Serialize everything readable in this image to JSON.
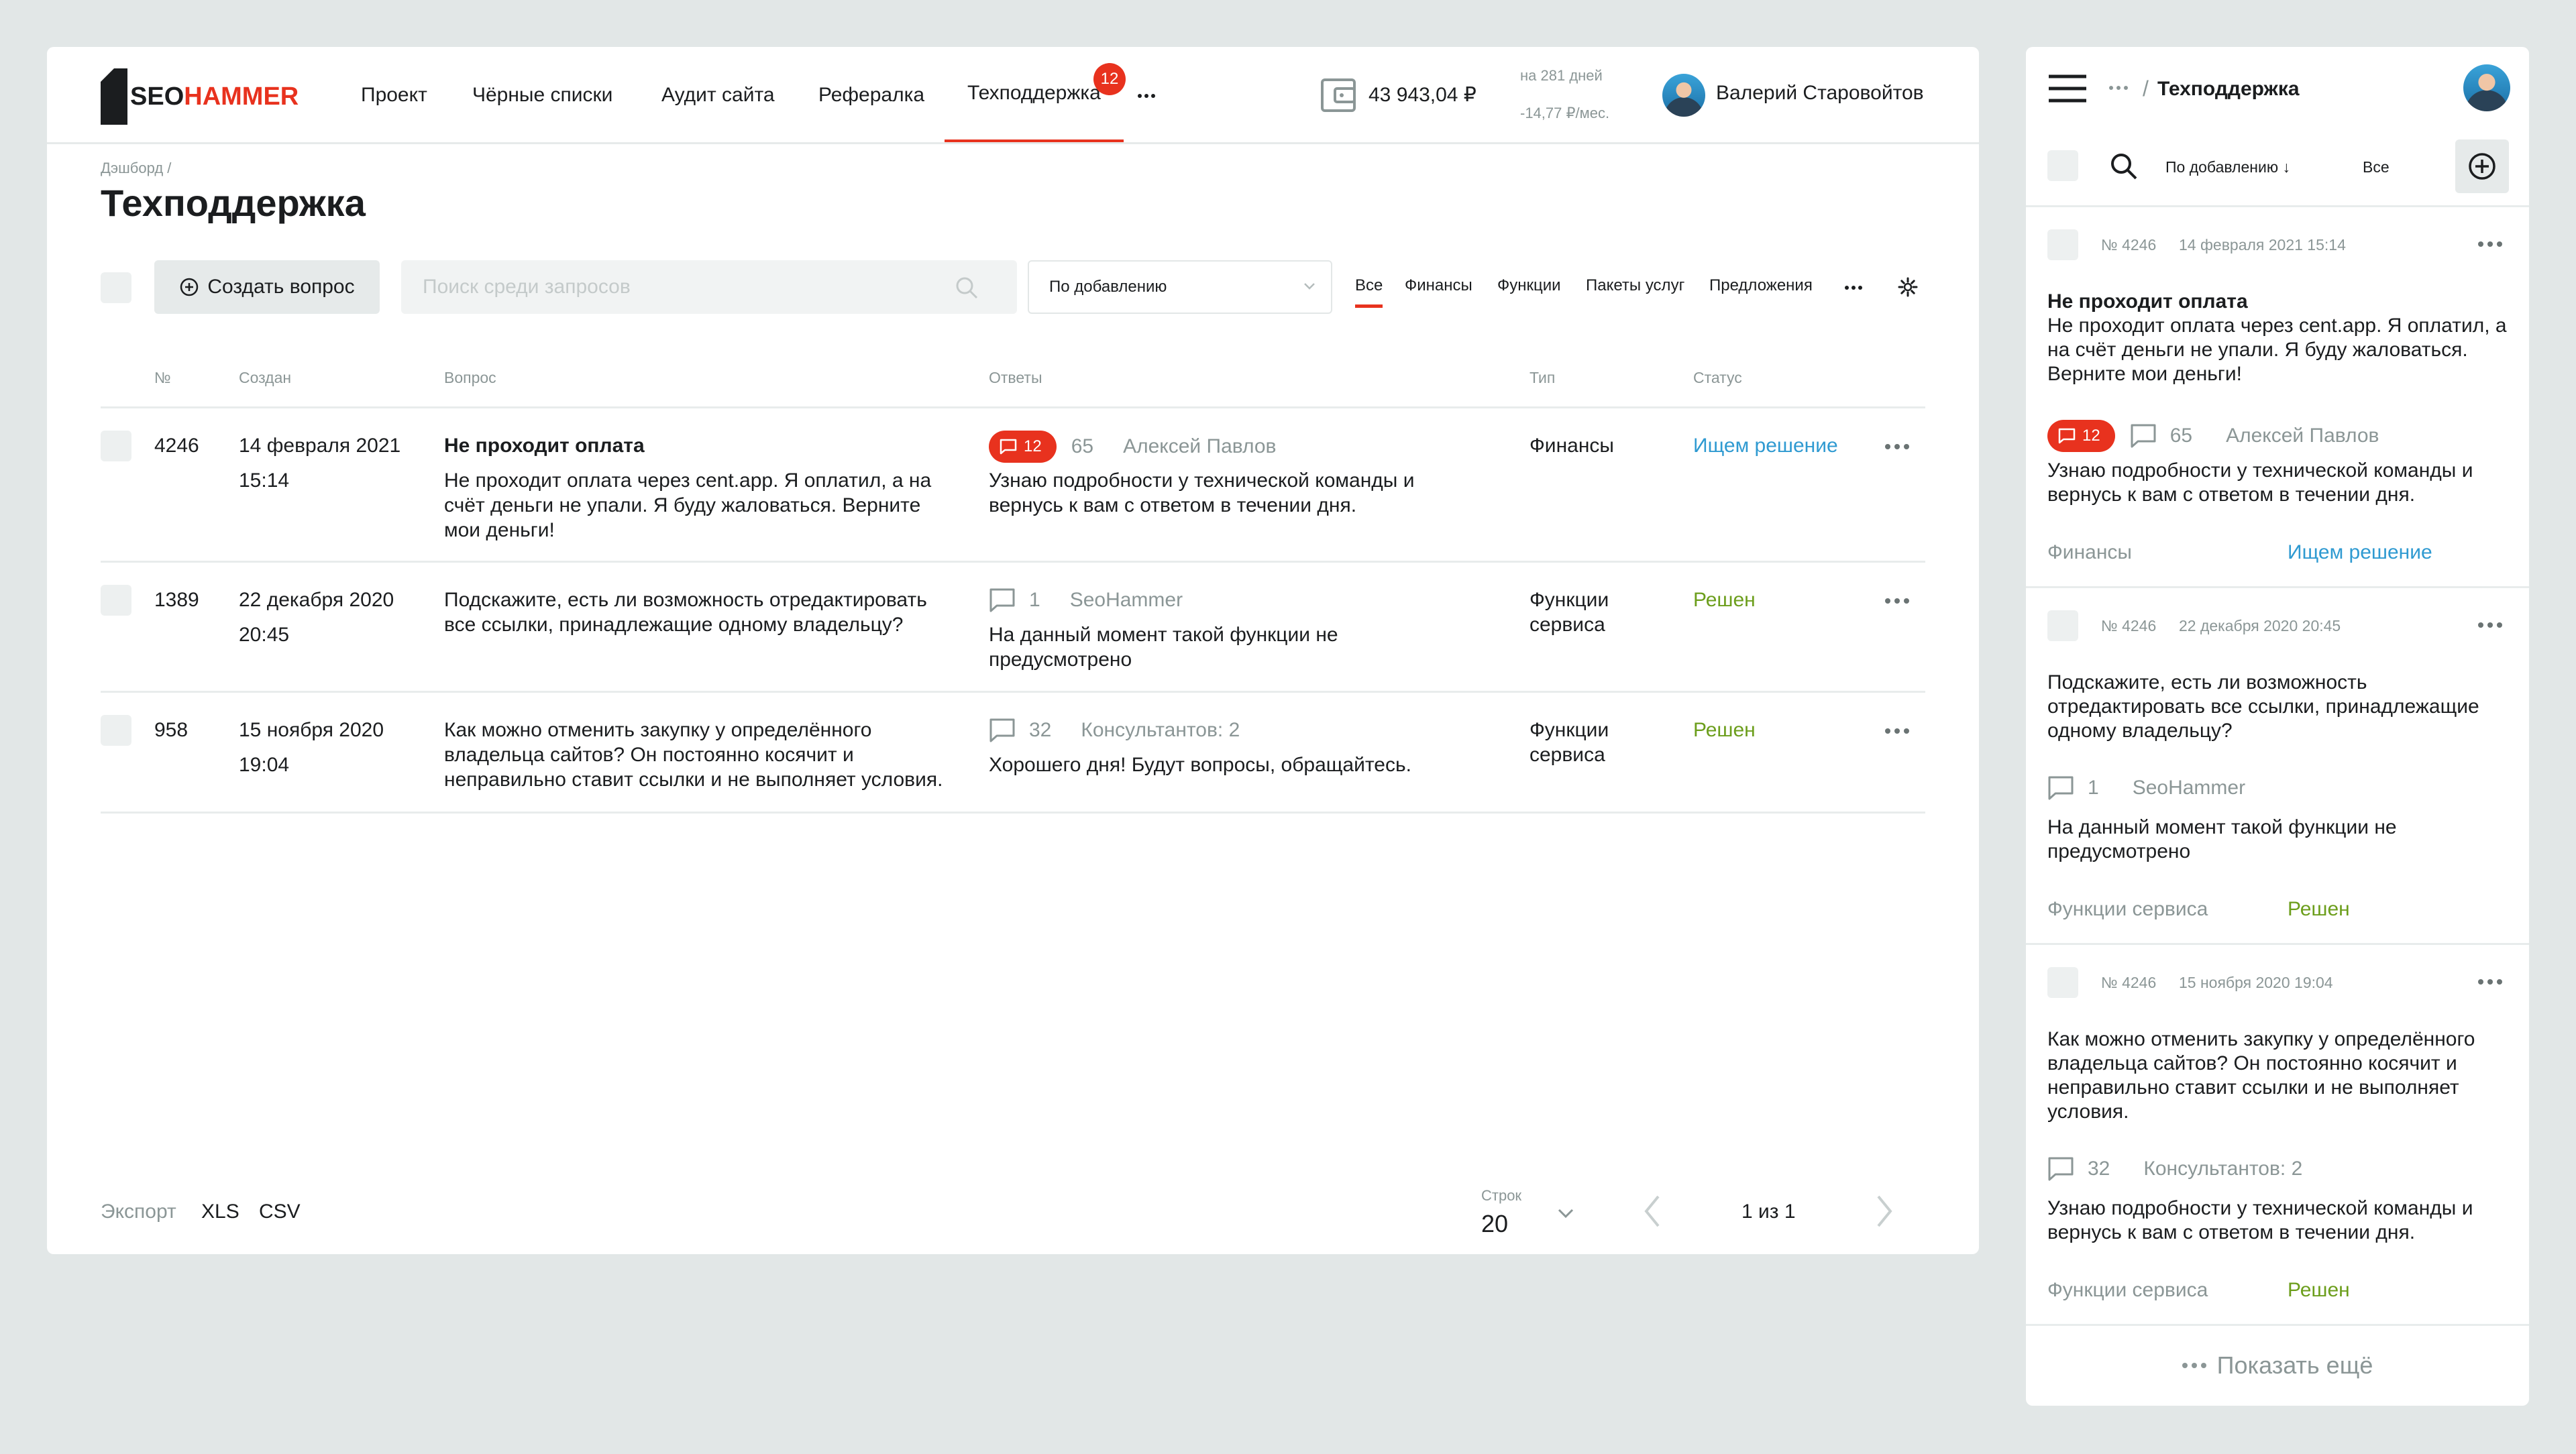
{
  "header": {
    "logo_part1": "SEO",
    "logo_part2": "HAMMER",
    "nav": [
      {
        "label": "Проект"
      },
      {
        "label": "Чёрные списки"
      },
      {
        "label": "Аудит сайта"
      },
      {
        "label": "Рефералка"
      },
      {
        "label": "Техподдержка",
        "badge": "12",
        "active": true
      }
    ],
    "balance": "43 943,04 ₽",
    "days": "на 281 дней",
    "per_month": "-14,77 ₽/мес.",
    "user_name": "Валерий Старовойтов"
  },
  "breadcrumb": "Дэшборд /",
  "page_title": "Техподдержка",
  "toolbar": {
    "create_label": "Создать вопрос",
    "search_placeholder": "Поиск среди запросов",
    "sort_label": "По добавлению",
    "filters": [
      "Все",
      "Финансы",
      "Функции",
      "Пакеты услуг",
      "Предложения"
    ]
  },
  "table": {
    "headers": [
      "№",
      "Создан",
      "Вопрос",
      "Ответы",
      "Тип",
      "Статус"
    ],
    "rows": [
      {
        "id": "4246",
        "date": "14 февраля 2021",
        "time": "15:14",
        "title": "Не проходит оплата",
        "q1": "Не проходит оплата через cent.app. Я оплатил, а на",
        "q2": "счёт деньги не упали. Я буду жаловаться. Верните",
        "q3": "мои деньги!",
        "unread": "12",
        "count": "65",
        "author": "Алексей Павлов",
        "a1": "Узнаю подробности у технической команды и",
        "a2": "вернусь к вам с ответом в течении дня.",
        "type1": "Финансы",
        "type2": "",
        "status": "Ищем решение"
      },
      {
        "id": "1389",
        "date": "22 декабря 2020",
        "time": "20:45",
        "q1": "Подскажите, есть ли возможность отредактировать",
        "q2": "все ссылки, принадлежащие одному владельцу?",
        "count": "1",
        "author": "SeoHammer",
        "a1": "На данный момент такой функции не",
        "a2": "предусмотрено",
        "type1": "Функции",
        "type2": "сервиса",
        "status": "Решен"
      },
      {
        "id": "958",
        "date": "15 ноября 2020",
        "time": "19:04",
        "q1": "Как можно отменить закупку у определённого",
        "q2": "владельца сайтов? Он постоянно косячит и",
        "q3": "неправильно ставит ссылки и не выполняет условия.",
        "count": "32",
        "author": "Консультантов: 2",
        "a1": "Хорошего дня! Будут вопросы, обращайтесь.",
        "type1": "Функции",
        "type2": "сервиса",
        "status": "Решен"
      }
    ]
  },
  "footer": {
    "export_label": "Экспорт",
    "xls": "XLS",
    "csv": "CSV",
    "rows_label": "Строк",
    "rows_value": "20",
    "page_info": "1 из 1"
  },
  "side": {
    "title": "Техподдержка",
    "sort_label": "По добавлению ↓",
    "filter_label": "Все",
    "cards": [
      {
        "num": "№ 4246",
        "date": "14 февраля 2021 15:14",
        "title": "Не проходит оплата",
        "q1": "Не проходит оплата через cent.app. Я оплатил, а",
        "q2": "на счёт деньги не упали. Я буду жаловаться.",
        "q3": "Верните мои деньги!",
        "unread": "12",
        "count": "65",
        "author": "Алексей Павлов",
        "a1": "Узнаю подробности у технической команды и",
        "a2": "вернусь к вам с ответом в течении дня.",
        "type": "Финансы",
        "status": "Ищем решение"
      },
      {
        "num": "№ 4246",
        "date": "22 декабря 2020 20:45",
        "q1": "Подскажите, есть ли возможность",
        "q2": "отредактировать все ссылки, принадлежащие",
        "q3": "одному владельцу?",
        "count": "1",
        "author": "SeoHammer",
        "a1": "На данный момент такой функции не",
        "a2": "предусмотрено",
        "type": "Функции сервиса",
        "status": "Решен"
      },
      {
        "num": "№ 4246",
        "date": "15 ноября 2020 19:04",
        "q1": "Как можно отменить закупку у определённого",
        "q2": "владельца сайтов? Он постоянно косячит и",
        "q3": "неправильно ставит ссылки и не выполняет",
        "q4": "условия.",
        "count": "32",
        "author": "Консультантов: 2",
        "a1": "Узнаю подробности у технической команды и",
        "a2": "вернусь к вам с ответом в течении дня.",
        "type": "Функции сервиса",
        "status": "Решен"
      }
    ],
    "show_more": "Показать ещё"
  },
  "colors": {
    "accent": "#e8321e",
    "resolved": "#6c9e1c",
    "searching": "#2f9ad1",
    "muted": "#8b9696"
  }
}
